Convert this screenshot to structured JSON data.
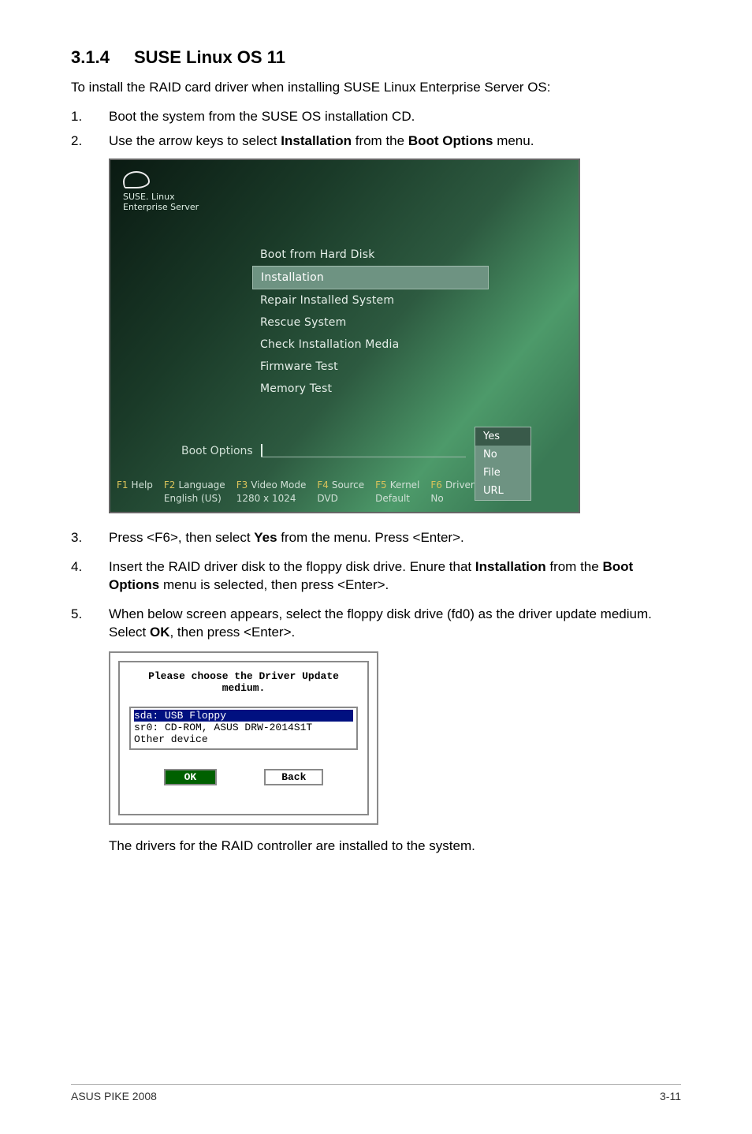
{
  "heading": {
    "number": "3.1.4",
    "title": "SUSE Linux OS 11"
  },
  "intro": "To install the RAID card driver when installing SUSE Linux Enterprise Server OS:",
  "steps_a": [
    {
      "idx": "1.",
      "pre": "Boot the system from the SUSE OS installation CD."
    },
    {
      "idx": "2.",
      "pre": "Use the arrow keys to select ",
      "bold1": "Installation",
      "mid": " from the ",
      "bold2": "Boot Options",
      "post": " menu."
    }
  ],
  "shot1": {
    "logo1": "SUSE. Linux",
    "logo2": "Enterprise Server",
    "menu": [
      "Boot from Hard Disk",
      "Installation",
      "Repair Installed System",
      "Rescue System",
      "Check Installation Media",
      "Firmware Test",
      "Memory Test"
    ],
    "selected_index": 1,
    "boot_options_label": "Boot Options",
    "driver_popup": [
      "Yes",
      "No",
      "File",
      "URL"
    ],
    "driver_popup_selected": 0,
    "fbar": [
      {
        "key": "F1",
        "label": "Help",
        "sub": ""
      },
      {
        "key": "F2",
        "label": "Language",
        "sub": "English (US)"
      },
      {
        "key": "F3",
        "label": "Video Mode",
        "sub": "1280 x 1024"
      },
      {
        "key": "F4",
        "label": "Source",
        "sub": "DVD"
      },
      {
        "key": "F5",
        "label": "Kernel",
        "sub": "Default"
      },
      {
        "key": "F6",
        "label": "Driver",
        "sub": "No"
      }
    ]
  },
  "steps_b": [
    {
      "idx": "3.",
      "pre": "Press <F6>, then select ",
      "bold1": "Yes",
      "post": " from the menu. Press <Enter>."
    },
    {
      "idx": "4.",
      "pre": "Insert the RAID driver disk to the floppy disk drive. Enure that ",
      "bold1": "Installation",
      "mid": " from the ",
      "bold2": "Boot Options",
      "post": " menu is selected, then press <Enter>."
    },
    {
      "idx": "5.",
      "pre": "When below screen appears, select the floppy disk drive (fd0) as the driver update medium. Select ",
      "bold1": "OK",
      "post": ", then press <Enter>."
    }
  ],
  "shot2": {
    "title": "Please choose the Driver Update medium.",
    "rows": [
      "sda: USB Floppy",
      "sr0: CD-ROM, ASUS DRW-2014S1T",
      "Other device"
    ],
    "highlight_index": 0,
    "ok": "OK",
    "back": "Back"
  },
  "closing": "The drivers for the RAID controller are installed to the system.",
  "footer": {
    "left": "ASUS PIKE 2008",
    "right": "3-11"
  }
}
